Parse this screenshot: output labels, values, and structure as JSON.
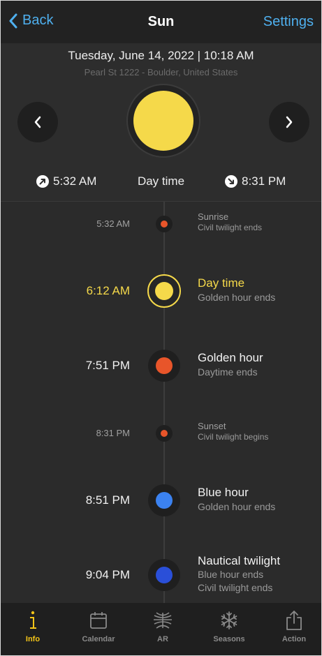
{
  "nav": {
    "back_label": "Back",
    "title": "Sun",
    "settings_label": "Settings"
  },
  "header": {
    "date": "Tuesday, June 14, 2022 | 10:18 AM",
    "location": "Pearl St 1222 - Boulder, United States",
    "sunrise": "5:32 AM",
    "sunset": "8:31 PM",
    "current_phase": "Day time"
  },
  "timeline": [
    {
      "time": "5:32 AM",
      "title": "Sunrise",
      "subtitles": [
        "Civil twilight ends"
      ],
      "size": "small",
      "color": "#e8552a"
    },
    {
      "time": "6:12 AM",
      "title": "Day time",
      "subtitles": [
        "Golden hour ends"
      ],
      "size": "active",
      "color": "#f5d94a"
    },
    {
      "time": "7:51 PM",
      "title": "Golden hour",
      "subtitles": [
        "Daytime ends"
      ],
      "size": "large",
      "color": "#e8552a"
    },
    {
      "time": "8:31 PM",
      "title": "Sunset",
      "subtitles": [
        "Civil twilight begins"
      ],
      "size": "small",
      "color": "#e8552a"
    },
    {
      "time": "8:51 PM",
      "title": "Blue hour",
      "subtitles": [
        "Golden hour ends"
      ],
      "size": "large",
      "color": "#3b82f0"
    },
    {
      "time": "9:04 PM",
      "title": "Nautical twilight",
      "subtitles": [
        "Blue hour ends",
        "Civil twilight ends"
      ],
      "size": "large",
      "color": "#2a4fd8"
    }
  ],
  "tabs": [
    {
      "label": "Info",
      "icon": "info-icon",
      "active": true
    },
    {
      "label": "Calendar",
      "icon": "calendar-icon",
      "active": false
    },
    {
      "label": "AR",
      "icon": "ar-icon",
      "active": false
    },
    {
      "label": "Seasons",
      "icon": "snowflake-icon",
      "active": false
    },
    {
      "label": "Action",
      "icon": "share-icon",
      "active": false
    }
  ],
  "colors": {
    "accent_blue": "#4fb0ef",
    "active_yellow": "#f5c518",
    "sun_yellow": "#f5d94a"
  }
}
